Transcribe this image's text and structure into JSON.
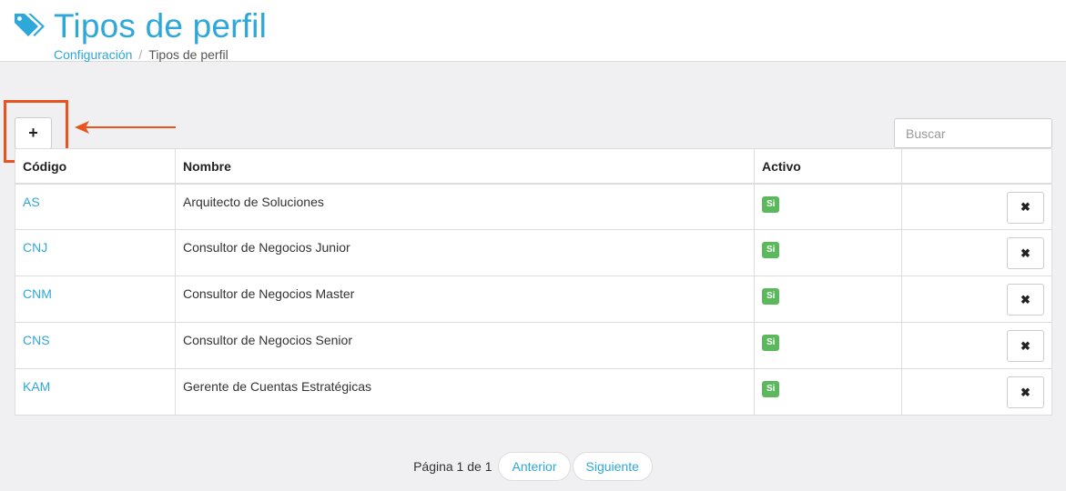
{
  "header": {
    "title": "Tipos de perfil",
    "icon": "tag-icon",
    "breadcrumb": {
      "parent": "Configuración",
      "separator": "/",
      "current": "Tipos de perfil"
    }
  },
  "toolbar": {
    "add_label": "+",
    "search_placeholder": "Buscar"
  },
  "table": {
    "columns": [
      "Código",
      "Nombre",
      "Activo",
      ""
    ],
    "rows": [
      {
        "code": "AS",
        "name": "Arquitecto de Soluciones",
        "active": "Si",
        "delete_label": "✖"
      },
      {
        "code": "CNJ",
        "name": "Consultor de Negocios Junior",
        "active": "Si",
        "delete_label": "✖"
      },
      {
        "code": "CNM",
        "name": "Consultor de Negocios Master",
        "active": "Si",
        "delete_label": "✖"
      },
      {
        "code": "CNS",
        "name": "Consultor de Negocios Senior",
        "active": "Si",
        "delete_label": "✖"
      },
      {
        "code": "KAM",
        "name": "Gerente de Cuentas Estratégicas",
        "active": "Si",
        "delete_label": "✖"
      }
    ]
  },
  "pagination": {
    "info": "Página 1 de 1",
    "prev": "Anterior",
    "next": "Siguiente"
  },
  "colors": {
    "accent": "#2ea7d9",
    "highlight": "#e8541f",
    "active_badge": "#5cb85c"
  }
}
